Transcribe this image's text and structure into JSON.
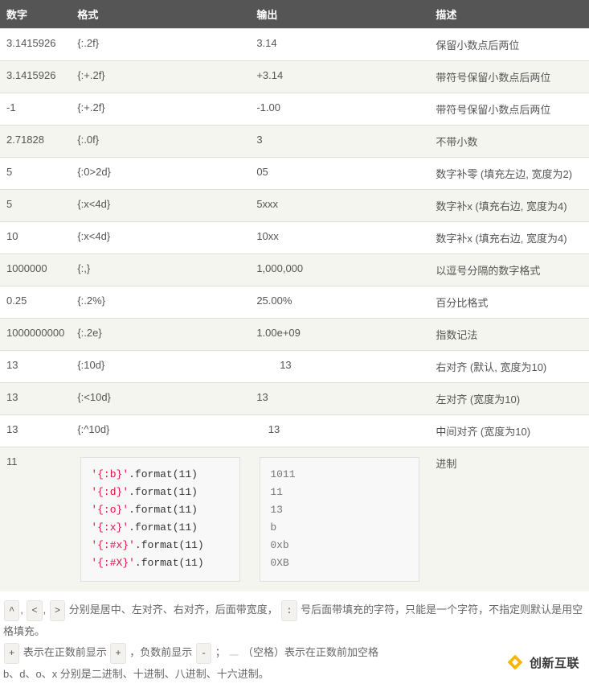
{
  "headers": [
    "数字",
    "格式",
    "输出",
    "描述"
  ],
  "rows": [
    {
      "number": "3.1415926",
      "format": "{:.2f}",
      "output": "3.14",
      "desc": "保留小数点后两位"
    },
    {
      "number": "3.1415926",
      "format": "{:+.2f}",
      "output": "+3.14",
      "desc": "带符号保留小数点后两位"
    },
    {
      "number": "-1",
      "format": "{:+.2f}",
      "output": "-1.00",
      "desc": "带符号保留小数点后两位"
    },
    {
      "number": "2.71828",
      "format": "{:.0f}",
      "output": "3",
      "desc": "不带小数"
    },
    {
      "number": "5",
      "format": "{:0>2d}",
      "output": "05",
      "desc": "数字补零 (填充左边, 宽度为2)"
    },
    {
      "number": "5",
      "format": "{:x<4d}",
      "output": "5xxx",
      "desc": "数字补x (填充右边, 宽度为4)"
    },
    {
      "number": "10",
      "format": "{:x<4d}",
      "output": "10xx",
      "desc": "数字补x (填充右边, 宽度为4)"
    },
    {
      "number": "1000000",
      "format": "{:,}",
      "output": "1,000,000",
      "desc": "以逗号分隔的数字格式"
    },
    {
      "number": "0.25",
      "format": "{:.2%}",
      "output": "25.00%",
      "desc": "百分比格式"
    },
    {
      "number": "1000000000",
      "format": "{:.2e}",
      "output": "1.00e+09",
      "desc": "指数记法"
    },
    {
      "number": "13",
      "format": "{:10d}",
      "output": "        13",
      "desc": "右对齐 (默认, 宽度为10)"
    },
    {
      "number": "13",
      "format": "{:<10d}",
      "output": "13",
      "desc": "左对齐 (宽度为10)"
    },
    {
      "number": "13",
      "format": "{:^10d}",
      "output": "    13",
      "desc": "中间对齐 (宽度为10)"
    }
  ],
  "codeRow": {
    "number": "11",
    "codeLines": [
      {
        "fmt": "'{:b}'",
        "rest": ".format(11)"
      },
      {
        "fmt": "'{:d}'",
        "rest": ".format(11)"
      },
      {
        "fmt": "'{:o}'",
        "rest": ".format(11)"
      },
      {
        "fmt": "'{:x}'",
        "rest": ".format(11)"
      },
      {
        "fmt": "'{:#x}'",
        "rest": ".format(11)"
      },
      {
        "fmt": "'{:#X}'",
        "rest": ".format(11)"
      }
    ],
    "outputLines": [
      "1011",
      "11",
      "13",
      "b",
      "0xb",
      "0XB"
    ],
    "desc": "进制"
  },
  "notes": {
    "line1": {
      "chips": [
        "^",
        "<",
        ">"
      ],
      "mid1": "分别是居中、左对齐、右对齐，后面带宽度，",
      "chip2": ":",
      "tail": "号后面带填充的字符，只能是一个字符，不指定则默认是用空格填充。"
    },
    "line2": {
      "chip1": "+",
      "mid1": "表示在正数前显示",
      "chip2": "+",
      "mid2": "，负数前显示",
      "chip3": "-",
      "mid3": "；",
      "chip4": " ",
      "tail": "（空格）表示在正数前加空格"
    },
    "line3": "b、d、o、x 分别是二进制、十进制、八进制、十六进制。"
  },
  "watermark": "创新互联"
}
